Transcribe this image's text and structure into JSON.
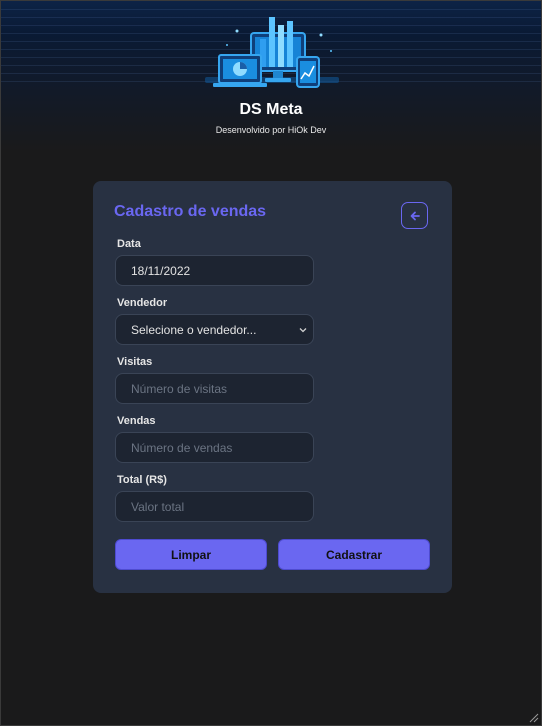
{
  "header": {
    "title": "DS Meta",
    "subtitle": "Desenvolvido por HiOk Dev"
  },
  "form": {
    "title": "Cadastro de vendas",
    "back_icon": "arrow-left-icon",
    "fields": {
      "data": {
        "label": "Data",
        "value": "18/11/2022"
      },
      "vendedor": {
        "label": "Vendedor",
        "value": "Selecione o vendedor..."
      },
      "visitas": {
        "label": "Visitas",
        "placeholder": "Número de visitas"
      },
      "vendas": {
        "label": "Vendas",
        "placeholder": "Número de vendas"
      },
      "total": {
        "label": "Total (R$)",
        "placeholder": "Valor total"
      }
    },
    "buttons": {
      "clear": "Limpar",
      "submit": "Cadastrar"
    }
  },
  "colors": {
    "accent": "#6a67f1",
    "card": "#283142",
    "background": "#1a1a1b"
  }
}
